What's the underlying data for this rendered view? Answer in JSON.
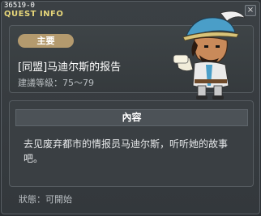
{
  "window": {
    "quest_id": "36519-0",
    "title": "QUEST INFO",
    "close_label": "×"
  },
  "header": {
    "tier": "主要",
    "quest_name": "[同盟]马迪尔斯的报告",
    "level_requirement": "建議等級：75～79"
  },
  "content": {
    "section_title": "內容",
    "description": "去见废弃都市的情报员马迪尔斯，听听她的故事吧。"
  },
  "footer": {
    "status": "狀態：可開始"
  },
  "npc": {
    "icon": "npc-portrait",
    "hat_color": "#4a9ec8",
    "skin_color": "#c98a5a",
    "coat_color": "#eaeaea"
  }
}
